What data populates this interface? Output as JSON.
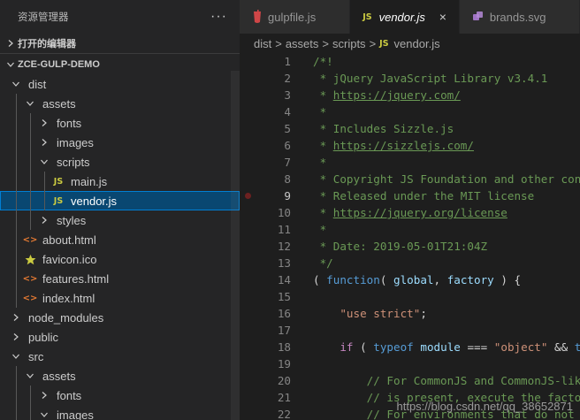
{
  "explorer": {
    "title": "资源管理器",
    "more": "···",
    "open_editors": "打开的编辑器",
    "project": "ZCE-GULP-DEMO"
  },
  "tree": [
    {
      "label": "dist",
      "type": "folder",
      "open": true,
      "depth": 1
    },
    {
      "label": "assets",
      "type": "folder",
      "open": true,
      "depth": 2
    },
    {
      "label": "fonts",
      "type": "folder",
      "open": false,
      "depth": 3
    },
    {
      "label": "images",
      "type": "folder",
      "open": false,
      "depth": 3
    },
    {
      "label": "scripts",
      "type": "folder",
      "open": true,
      "depth": 3
    },
    {
      "label": "main.js",
      "type": "js",
      "depth": 4
    },
    {
      "label": "vendor.js",
      "type": "js",
      "depth": 4,
      "selected": true
    },
    {
      "label": "styles",
      "type": "folder",
      "open": false,
      "depth": 3
    },
    {
      "label": "about.html",
      "type": "html",
      "depth": 2
    },
    {
      "label": "favicon.ico",
      "type": "ico",
      "depth": 2
    },
    {
      "label": "features.html",
      "type": "html",
      "depth": 2
    },
    {
      "label": "index.html",
      "type": "html",
      "depth": 2
    },
    {
      "label": "node_modules",
      "type": "folder",
      "open": false,
      "depth": 1
    },
    {
      "label": "public",
      "type": "folder",
      "open": false,
      "depth": 1
    },
    {
      "label": "src",
      "type": "folder",
      "open": true,
      "depth": 1
    },
    {
      "label": "assets",
      "type": "folder",
      "open": true,
      "depth": 2
    },
    {
      "label": "fonts",
      "type": "folder",
      "open": false,
      "depth": 3
    },
    {
      "label": "images",
      "type": "folder",
      "open": true,
      "depth": 3
    }
  ],
  "tabs": [
    {
      "label": "gulpfile.js",
      "icon": "gulp-icon",
      "active": false
    },
    {
      "label": "vendor.js",
      "icon": "js-icon",
      "active": true,
      "close": "×"
    },
    {
      "label": "brands.svg",
      "icon": "svg-icon",
      "active": false
    }
  ],
  "breadcrumb": {
    "parts": [
      "dist",
      "assets",
      "scripts"
    ],
    "file": "vendor.js",
    "file_icon": "JS",
    "separator": ">"
  },
  "js_badge": "JS",
  "html_badge": "<>",
  "code": {
    "lines": [
      {
        "n": "1",
        "t": "/*!"
      },
      {
        "n": "2",
        "t": " * jQuery JavaScript Library v3.4.1"
      },
      {
        "n": "3",
        "t": " * ",
        "url": "https://jquery.com/"
      },
      {
        "n": "4",
        "t": " *"
      },
      {
        "n": "5",
        "t": " * Includes Sizzle.js"
      },
      {
        "n": "6",
        "t": " * ",
        "url": "https://sizzlejs.com/"
      },
      {
        "n": "7",
        "t": " *"
      },
      {
        "n": "8",
        "t": " * Copyright JS Foundation and other contributors"
      },
      {
        "n": "9",
        "t": " * Released under the MIT license",
        "breakpoint": true
      },
      {
        "n": "10",
        "t": " * ",
        "url": "https://jquery.org/license"
      },
      {
        "n": "11",
        "t": " *"
      },
      {
        "n": "12",
        "t": " * Date: 2019-05-01T21:04Z"
      },
      {
        "n": "13",
        "t": " */"
      },
      {
        "n": "14",
        "t": "",
        "code": "fn_open"
      },
      {
        "n": "15",
        "t": ""
      },
      {
        "n": "16",
        "t": "",
        "code": "use_strict"
      },
      {
        "n": "17",
        "t": ""
      },
      {
        "n": "18",
        "t": "",
        "code": "if_typeof"
      },
      {
        "n": "19",
        "t": ""
      },
      {
        "n": "20",
        "t": "\t\t// For CommonJS and CommonJS-like environments"
      },
      {
        "n": "21",
        "t": "\t\t// is present, execute the factory and get jQuery."
      },
      {
        "n": "22",
        "t": "\t\t// For environments that do not have a `window`"
      }
    ],
    "tokens": {
      "fn_open": [
        {
          "c": "p",
          "t": "( "
        },
        {
          "c": "k",
          "t": "function"
        },
        {
          "c": "p",
          "t": "( "
        },
        {
          "c": "v",
          "t": "global"
        },
        {
          "c": "p",
          "t": ", "
        },
        {
          "c": "v",
          "t": "factory"
        },
        {
          "c": "p",
          "t": " ) {"
        }
      ],
      "use_strict": [
        {
          "c": "p",
          "t": "\t"
        },
        {
          "c": "s",
          "t": "\"use strict\""
        },
        {
          "c": "p",
          "t": ";"
        }
      ],
      "if_typeof": [
        {
          "c": "p",
          "t": "\t"
        },
        {
          "c": "ctl",
          "t": "if"
        },
        {
          "c": "p",
          "t": " ( "
        },
        {
          "c": "k",
          "t": "typeof"
        },
        {
          "c": "p",
          "t": " "
        },
        {
          "c": "v",
          "t": "module"
        },
        {
          "c": "p",
          "t": " === "
        },
        {
          "c": "s",
          "t": "\"object\""
        },
        {
          "c": "p",
          "t": " && "
        },
        {
          "c": "k",
          "t": "typeof"
        }
      ]
    }
  },
  "watermark": "https://blog.csdn.net/qq_38652871"
}
